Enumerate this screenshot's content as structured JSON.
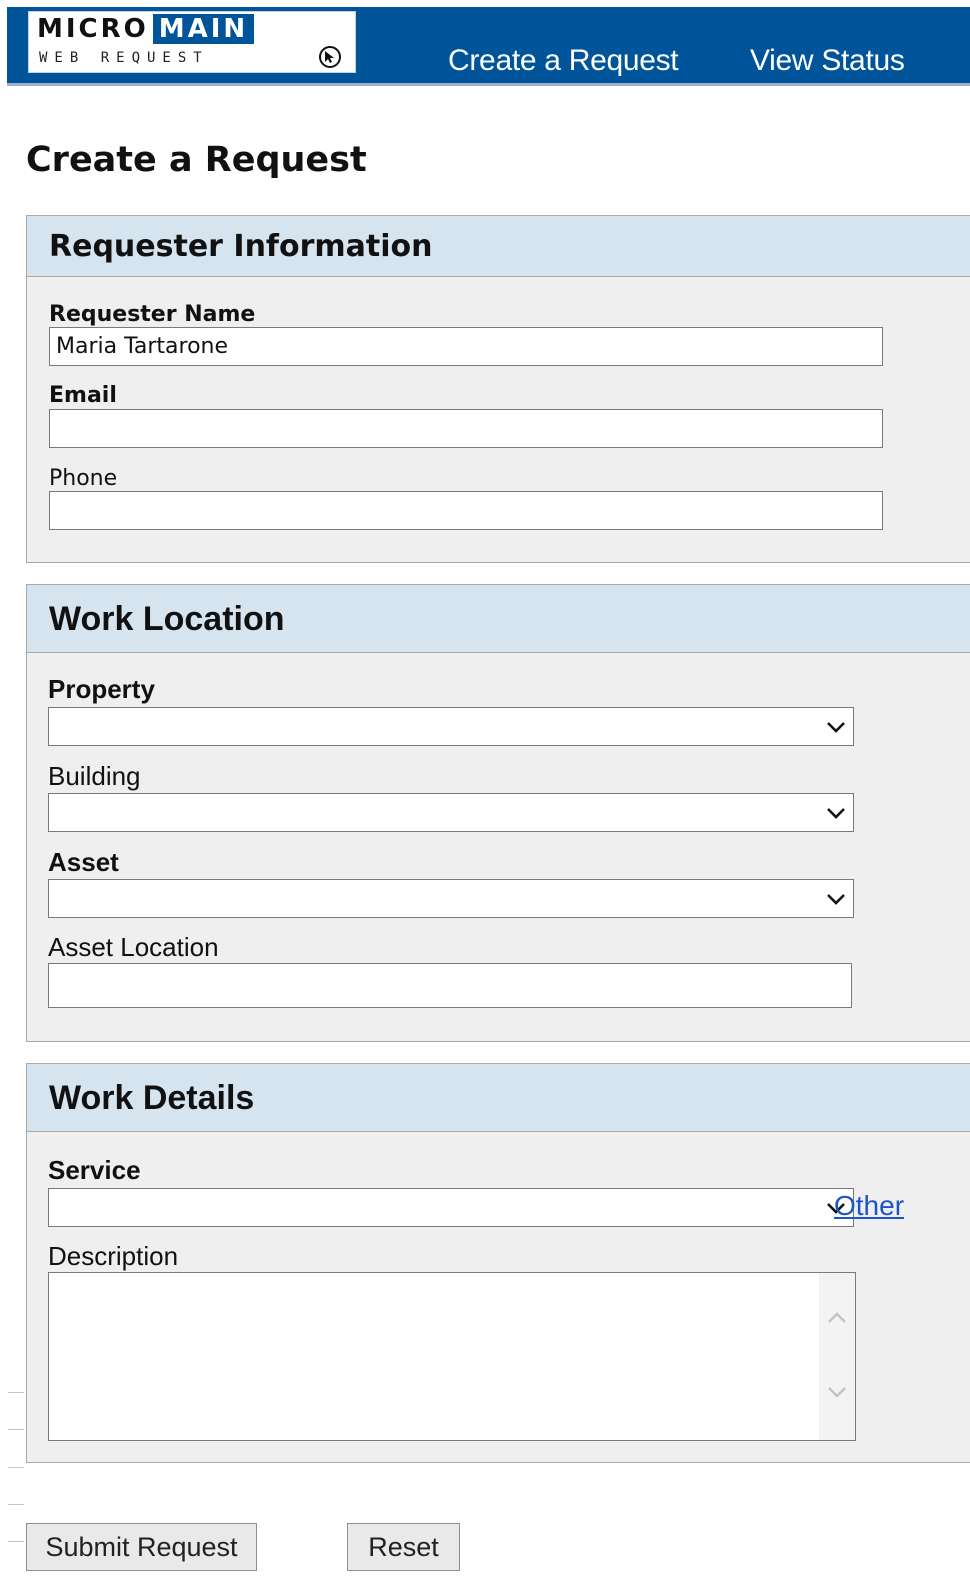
{
  "header": {
    "logo": {
      "word_left": "MICRO",
      "word_right": "MAIN",
      "subtitle": "WEB REQUEST"
    },
    "nav": [
      "Create a Request",
      "View Status"
    ]
  },
  "page_title": "Create a Request",
  "requester": {
    "heading": "Requester Information",
    "name_label": "Requester Name",
    "name_value": "Maria Tartarone",
    "email_label": "Email",
    "email_value": "",
    "phone_label": "Phone",
    "phone_value": ""
  },
  "location": {
    "heading": "Work Location",
    "property_label": "Property",
    "property_value": "",
    "building_label": "Building",
    "building_value": "",
    "asset_label": "Asset",
    "asset_value": "",
    "asset_location_label": "Asset Location",
    "asset_location_value": ""
  },
  "details": {
    "heading": "Work Details",
    "service_label": "Service",
    "service_value": "",
    "other_link": "Other",
    "description_label": "Description",
    "description_value": ""
  },
  "buttons": {
    "submit": "Submit Request",
    "reset": "Reset"
  },
  "colors": {
    "header_bg": "#00549a",
    "panel_head_bg": "#d5e4ef",
    "panel_bg": "#efefef",
    "link": "#1a56c8"
  },
  "icons": {
    "select_arrow": "chevron-down-icon",
    "logo_cursor": "cursor-icon"
  }
}
